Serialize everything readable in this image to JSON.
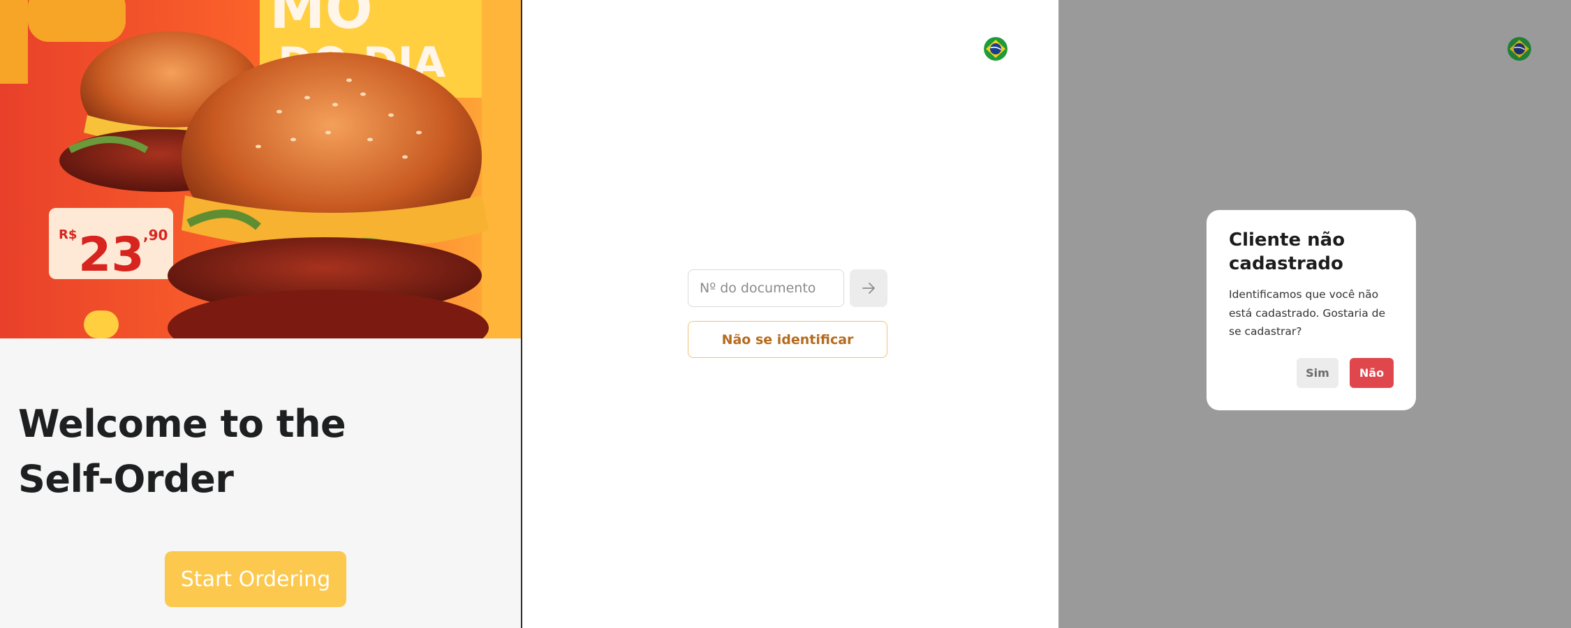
{
  "screen1": {
    "hero_image": {
      "banner_text_line1": "MO",
      "banner_text_line2": "DO DIA",
      "price_currency": "R$",
      "price_main": "23",
      "price_cents": ",90"
    },
    "welcome_title": "Welcome to the Self-Order",
    "start_button_label": "Start Ordering"
  },
  "screen2": {
    "language_icon": "brazil-flag-icon",
    "document_input": {
      "placeholder": "Nº do documento",
      "value": ""
    },
    "submit_icon": "arrow-right-icon",
    "skip_button_label": "Não se identificar"
  },
  "screen3": {
    "language_icon": "brazil-flag-icon",
    "modal": {
      "title": "Cliente não cadastrado",
      "message": "Identificamos que você não está cadastrado. Gostaria de se cadastrar?",
      "yes_label": "Sim",
      "no_label": "Não"
    }
  },
  "colors": {
    "accent_yellow": "#fcc84d",
    "skip_border": "#f2c37a",
    "skip_text": "#b56b1e",
    "danger_red": "#e0474d",
    "overlay_gray": "#9a9a9a"
  }
}
